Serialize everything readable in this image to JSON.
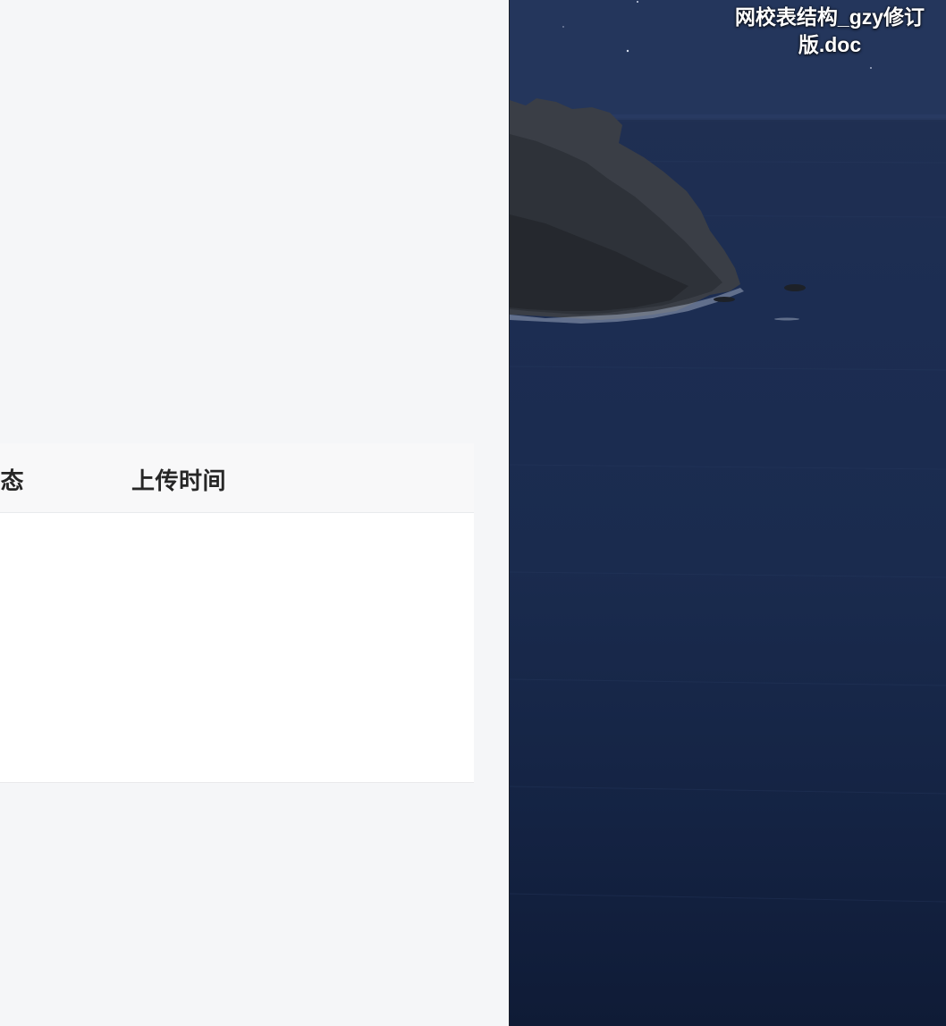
{
  "table": {
    "columns": [
      {
        "label": "状态"
      },
      {
        "label": "上传时间"
      }
    ],
    "rows": []
  },
  "desktop": {
    "files": [
      {
        "name": "网校表结构_gzy修订版.doc"
      }
    ],
    "wallpaper": "rocky-coast-night-sea"
  },
  "colors": {
    "app_background": "#f5f6f8",
    "table_header_bg": "#f8f8f9",
    "header_text": "#262626",
    "sea_dark": "#142343"
  }
}
